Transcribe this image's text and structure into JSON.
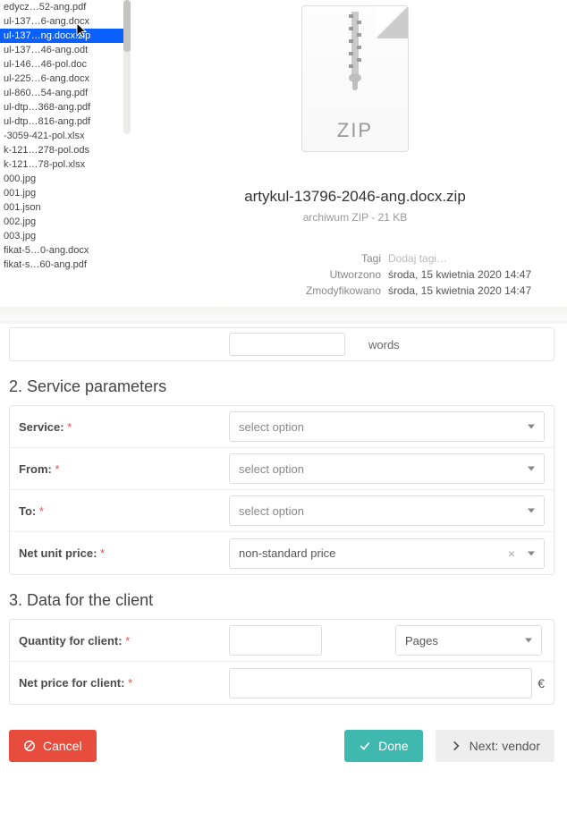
{
  "finder": {
    "files": [
      "edycz…52-ang.pdf",
      "ul-137…6-ang.docx",
      "ul-137…ng.docx.zip",
      "ul-137…46-ang.odt",
      "ul-146…46-pol.doc",
      "ul-225…6-ang.docx",
      "ul-860…54-ang.pdf",
      "ul-dtp…368-ang.pdf",
      "ul-dtp…816-ang.pdf",
      "-3059-421-pol.xlsx",
      "k-121…278-pol.ods",
      "k-121…78-pol.xlsx",
      "000.jpg",
      "001.jpg",
      "001.json",
      "002.jpg",
      "003.jpg",
      "fikat-5…0-ang.docx",
      "fikat-s…60-ang.pdf"
    ],
    "selected_index": 2,
    "preview": {
      "icon_label": "ZIP",
      "title": "artykul-13796-2046-ang.docx.zip",
      "subtitle": "archiwum ZIP - 21 KB",
      "meta": [
        {
          "label": "Tagi",
          "value": "Dodaj tagi…",
          "placeholder": true
        },
        {
          "label": "Utworzono",
          "value": "środa, 15 kwietnia 2020 14:47"
        },
        {
          "label": "Zmodyfikowano",
          "value": "środa, 15 kwietnia 2020 14:47"
        }
      ]
    }
  },
  "form": {
    "words_indicator": "words",
    "section2": {
      "title": "2. Service parameters",
      "rows": {
        "service": {
          "label": "Service:",
          "placeholder": "select option"
        },
        "from": {
          "label": "From:",
          "placeholder": "select option"
        },
        "to": {
          "label": "To:",
          "placeholder": "select option"
        },
        "price": {
          "label": "Net unit price:",
          "value": "non-standard price"
        }
      }
    },
    "section3": {
      "title": "3. Data for the client",
      "rows": {
        "qty": {
          "label": "Quantity for client:",
          "unit": "Pages"
        },
        "net": {
          "label": "Net price for client:",
          "currency": "€"
        }
      }
    },
    "buttons": {
      "cancel": "Cancel",
      "done": "Done",
      "next": "Next: vendor"
    }
  }
}
